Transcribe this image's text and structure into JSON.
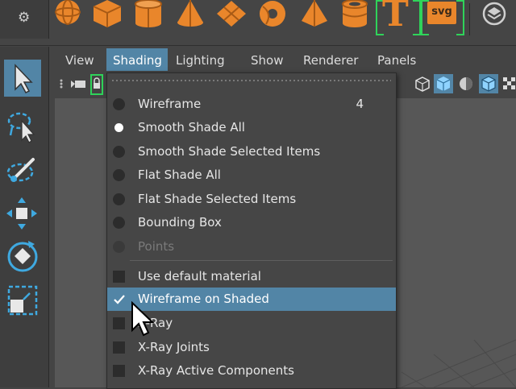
{
  "shelf": {
    "icons": [
      "sphere-icon",
      "cube-icon",
      "cylinder-icon",
      "cone-icon",
      "plane-icon",
      "torus-icon",
      "pyramid-icon",
      "pipe-icon",
      "text-icon",
      "svg-icon",
      "modeling-toolkit-icon"
    ],
    "text_tool_label": "T",
    "svg_tool_label": "svg",
    "accent_color": "#e9862b",
    "bracket_color": "#2fd35a"
  },
  "toolbox": {
    "tools": [
      {
        "name": "select-tool",
        "icon": "arrow-icon",
        "active": true
      },
      {
        "name": "lasso-tool",
        "icon": "lasso-icon",
        "active": false
      },
      {
        "name": "paint-select-tool",
        "icon": "brush-icon",
        "active": false
      },
      {
        "name": "move-tool",
        "icon": "move-icon",
        "active": false
      },
      {
        "name": "rotate-tool",
        "icon": "rotate-icon",
        "active": false
      },
      {
        "name": "scale-tool",
        "icon": "scale-icon",
        "active": false
      }
    ]
  },
  "menubar": {
    "items": [
      {
        "label": "View",
        "open": false
      },
      {
        "label": "Shading",
        "open": true
      },
      {
        "label": "Lighting",
        "open": false
      },
      {
        "label": "Show",
        "open": false
      },
      {
        "label": "Renderer",
        "open": false
      },
      {
        "label": "Panels",
        "open": false
      }
    ]
  },
  "shading_menu": {
    "items": [
      {
        "label": "Wireframe",
        "indicator": "radio",
        "selected": false,
        "hotkey": "4",
        "enabled": true
      },
      {
        "label": "Smooth Shade All",
        "indicator": "radio",
        "selected": true,
        "hotkey": "",
        "enabled": true
      },
      {
        "label": "Smooth Shade Selected Items",
        "indicator": "radio",
        "selected": false,
        "hotkey": "",
        "enabled": true
      },
      {
        "label": "Flat Shade All",
        "indicator": "radio",
        "selected": false,
        "hotkey": "",
        "enabled": true
      },
      {
        "label": "Flat Shade Selected Items",
        "indicator": "radio",
        "selected": false,
        "hotkey": "",
        "enabled": true
      },
      {
        "label": "Bounding Box",
        "indicator": "radio",
        "selected": false,
        "hotkey": "",
        "enabled": true
      },
      {
        "label": "Points",
        "indicator": "radio",
        "selected": false,
        "hotkey": "",
        "enabled": false
      },
      {
        "label": "Use default material",
        "indicator": "checkbox",
        "selected": false,
        "hotkey": "",
        "enabled": true
      },
      {
        "label": "Wireframe on Shaded",
        "indicator": "checkbox",
        "selected": true,
        "hotkey": "",
        "enabled": true,
        "highlighted": true
      },
      {
        "label": "X-Ray",
        "indicator": "checkbox",
        "selected": false,
        "hotkey": "",
        "enabled": true
      },
      {
        "label": "X-Ray Joints",
        "indicator": "checkbox",
        "selected": false,
        "hotkey": "",
        "enabled": true
      },
      {
        "label": "X-Ray Active Components",
        "indicator": "checkbox",
        "selected": false,
        "hotkey": "",
        "enabled": true
      }
    ]
  },
  "colors": {
    "highlight": "#5285a6",
    "menu_bg": "#464646",
    "viewport_bg": "#575757"
  }
}
